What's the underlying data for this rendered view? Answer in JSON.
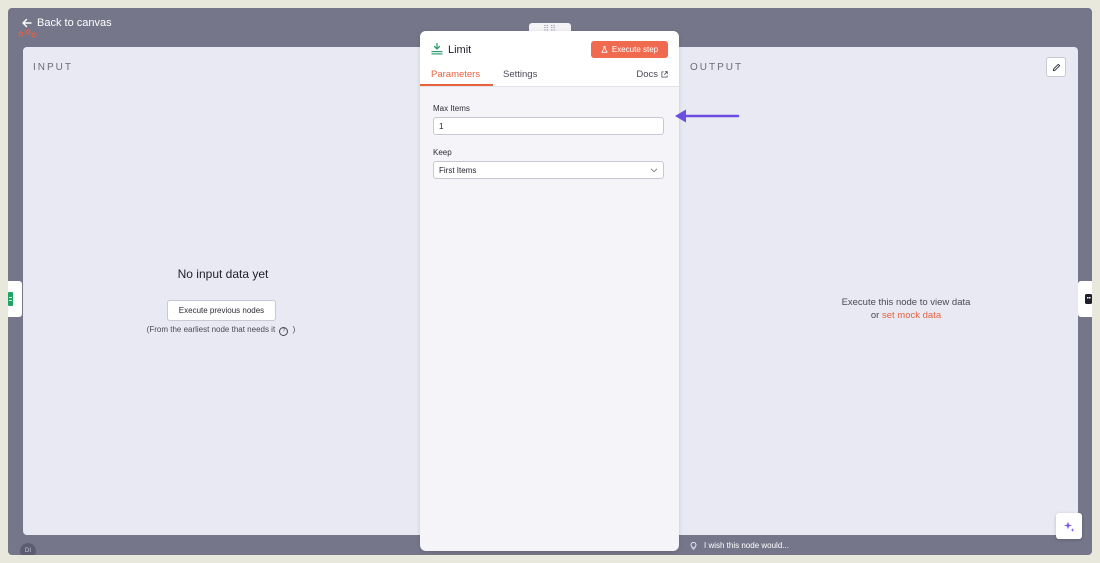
{
  "nav": {
    "back_label": "Back to canvas"
  },
  "input_panel": {
    "label": "INPUT",
    "empty_title": "No input data yet",
    "execute_previous_label": "Execute previous nodes",
    "note_before": "(From the earliest node that needs it",
    "note_after": ")"
  },
  "output_panel": {
    "label": "OUTPUT",
    "message_line1": "Execute this node to view data",
    "message_prefix": "or",
    "mock_link": "set mock data"
  },
  "node": {
    "title": "Limit",
    "execute_step_label": "Execute step",
    "tabs": [
      {
        "label": "Parameters",
        "active": true
      },
      {
        "label": "Settings",
        "active": false
      }
    ],
    "docs_label": "Docs",
    "fields": {
      "max_items": {
        "label": "Max Items",
        "value": "1"
      },
      "keep": {
        "label": "Keep",
        "value": "First Items"
      }
    }
  },
  "footer": {
    "wish_placeholder": "I wish this node would..."
  },
  "user": {
    "avatar_initials": "DI"
  },
  "colors": {
    "accent": "#e9613f",
    "execute_button": "#f06a4f",
    "annotation_arrow": "#6a4fe0",
    "canvas_overlay": "#76768a"
  },
  "icons": [
    "arrow-left-icon",
    "n8n-logo-icon",
    "grip-icon",
    "limit-node-icon",
    "flask-icon",
    "external-link-icon",
    "chevron-down-icon",
    "pencil-icon",
    "sparkle-icon",
    "lightbulb-icon",
    "help-circle-icon",
    "google-sheets-icon",
    "node-icon"
  ]
}
